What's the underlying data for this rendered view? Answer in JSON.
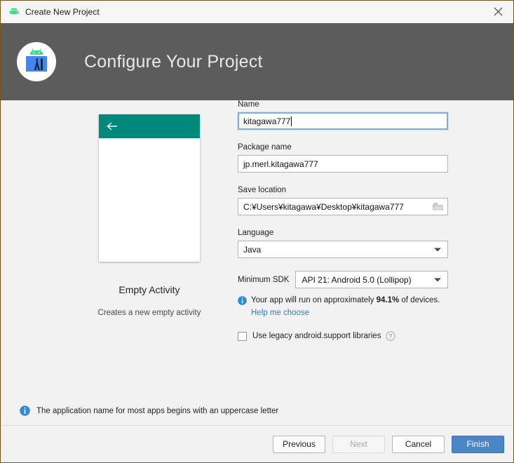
{
  "titlebar": {
    "title": "Create New Project",
    "app_icon": "android-robot-icon",
    "close_icon": "close-icon"
  },
  "header": {
    "title": "Configure Your Project",
    "logo_icon": "android-studio-logo-icon",
    "background": "#5c5c5c"
  },
  "preview": {
    "appbar_icon": "back-arrow-icon",
    "appbar_color": "#00897b",
    "title": "Empty Activity",
    "subtitle": "Creates a new empty activity"
  },
  "form": {
    "name": {
      "label": "Name",
      "value": "kitagawa777",
      "focused": true
    },
    "package_name": {
      "label": "Package name",
      "value": "jp.merl.kitagawa777"
    },
    "save_location": {
      "label": "Save location",
      "value": "C:¥Users¥kitagawa¥Desktop¥kitagawa777",
      "browse_icon": "folder-icon"
    },
    "language": {
      "label": "Language",
      "value": "Java",
      "dropdown_icon": "chevron-down-icon"
    },
    "minimum_sdk": {
      "label": "Minimum SDK",
      "value": "API 21: Android 5.0 (Lollipop)",
      "dropdown_icon": "chevron-down-icon"
    },
    "sdk_note": {
      "icon": "info-icon",
      "text_before": "Your app will run on approximately ",
      "percentage": "94.1%",
      "text_after": " of devices.",
      "link": "Help me choose",
      "link_color": "#2f7bc4"
    },
    "legacy_libraries": {
      "label": "Use legacy android.support libraries",
      "checked": false,
      "help_icon": "question-mark-icon"
    }
  },
  "notice": {
    "icon": "info-icon",
    "text": "The application name for most apps begins with an uppercase letter"
  },
  "footer": {
    "buttons": [
      {
        "label": "Previous",
        "state": "enabled",
        "style": "default"
      },
      {
        "label": "Next",
        "state": "disabled",
        "style": "default"
      },
      {
        "label": "Cancel",
        "state": "enabled",
        "style": "default"
      },
      {
        "label": "Finish",
        "state": "enabled",
        "style": "primary"
      }
    ],
    "primary_color": "#4a86c8"
  }
}
